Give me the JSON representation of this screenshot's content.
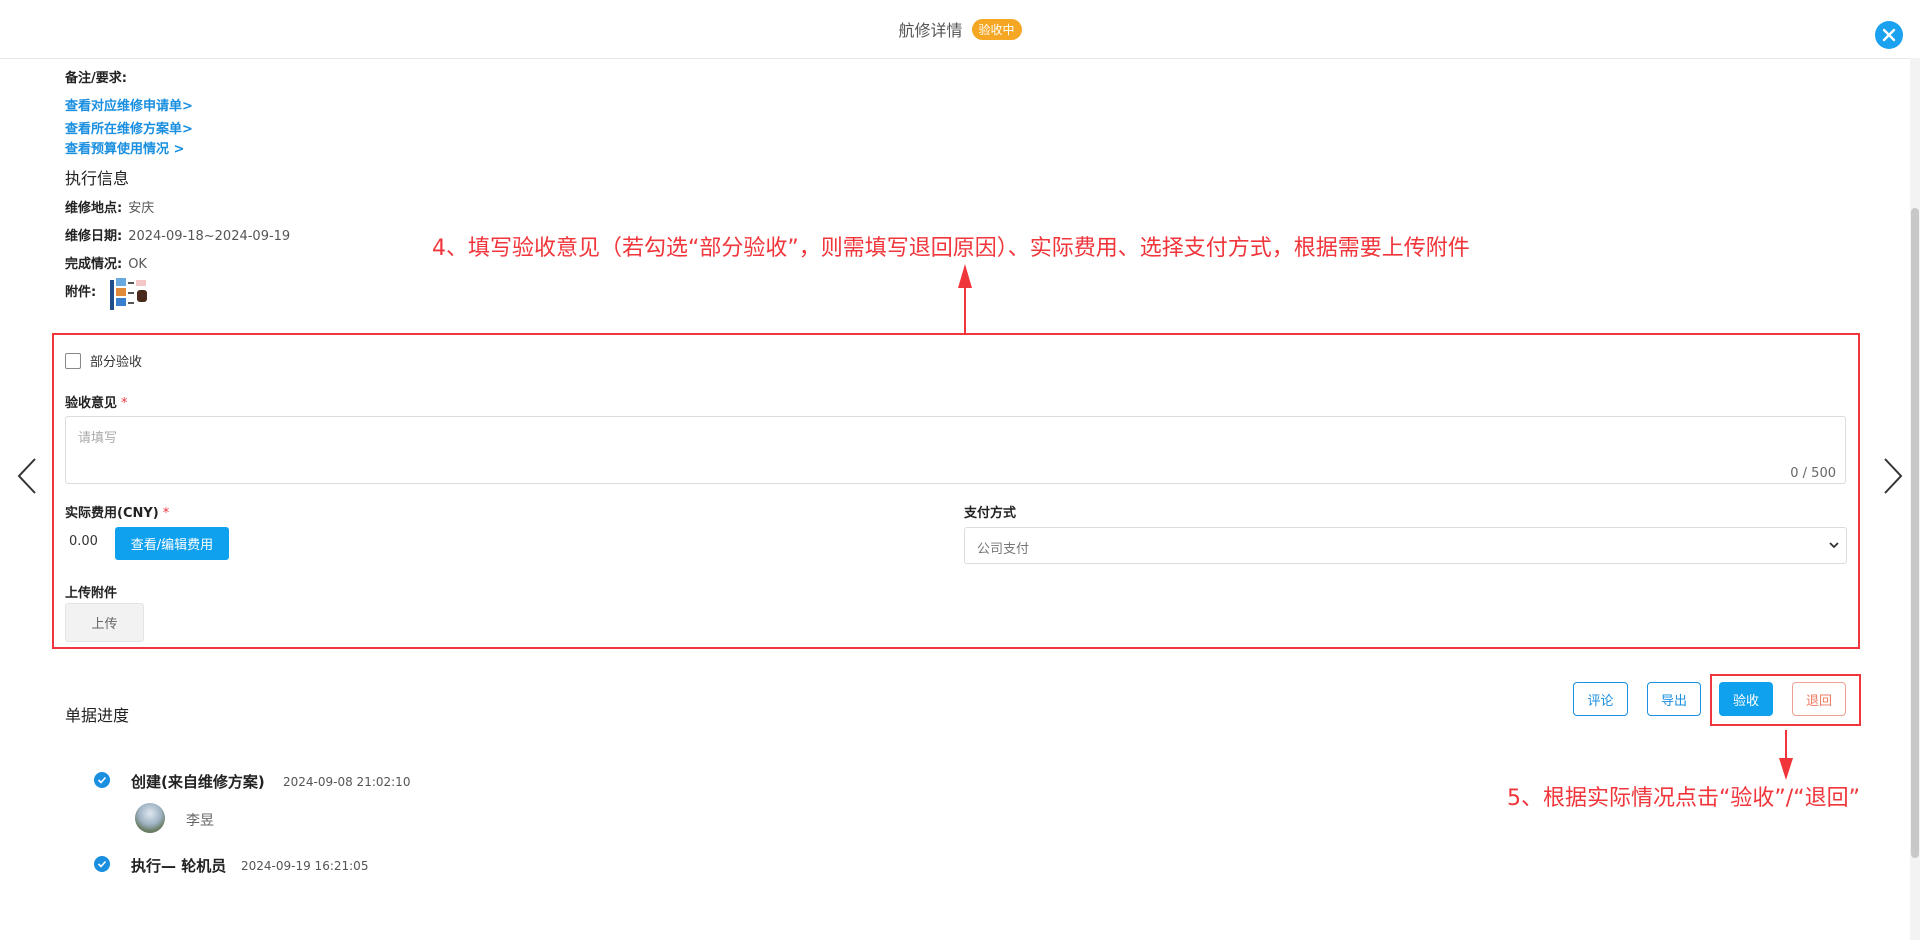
{
  "header": {
    "title": "航修详情",
    "status": "验收中"
  },
  "details": {
    "remark_label": "备注/要求:",
    "links": [
      "查看对应维修申请单>",
      "查看所在维修方案单>",
      "查看预算使用情况 >"
    ],
    "exec_title": "执行信息",
    "rows": [
      {
        "label": "维修地点:",
        "value": "安庆"
      },
      {
        "label": "维修日期:",
        "value": "2024-09-18~2024-09-19"
      },
      {
        "label": "完成情况:",
        "value": "OK"
      }
    ],
    "attachment_label": "附件:"
  },
  "form": {
    "partial_label": "部分验收",
    "opinion_label": "验收意见",
    "required_mark": "*",
    "opinion_placeholder": "请填写",
    "opinion_counter": "0 / 500",
    "cost_label": "实际费用(CNY)",
    "cost_value": "0.00",
    "cost_button": "查看/编辑费用",
    "payment_label": "支付方式",
    "payment_value": "公司支付",
    "upload_section_label": "上传附件",
    "upload_button": "上传"
  },
  "annotations": {
    "step4": "4、填写验收意见（若勾选“部分验收”，则需填写退回原因）、实际费用、选择支付方式，根据需要上传附件",
    "step5": "5、根据实际情况点击“验收”/“退回”"
  },
  "actions": {
    "comment": "评论",
    "export": "导出",
    "accept": "验收",
    "reject": "退回"
  },
  "progress": {
    "title": "单据进度",
    "items": [
      {
        "title": "创建(来自维修方案)",
        "time": "2024-09-08 21:02:10",
        "user": "李昱"
      },
      {
        "title": "执行— 轮机员",
        "time": "2024-09-19 16:21:05"
      }
    ]
  },
  "colors": {
    "accent": "#0fa0ee",
    "badge": "#f5a623",
    "annotation": "#f0353b"
  },
  "icons": [
    "close-icon",
    "chevron-left-icon",
    "chevron-right-icon",
    "chevron-down-icon",
    "check-icon",
    "arrow-up-icon",
    "arrow-down-icon"
  ]
}
